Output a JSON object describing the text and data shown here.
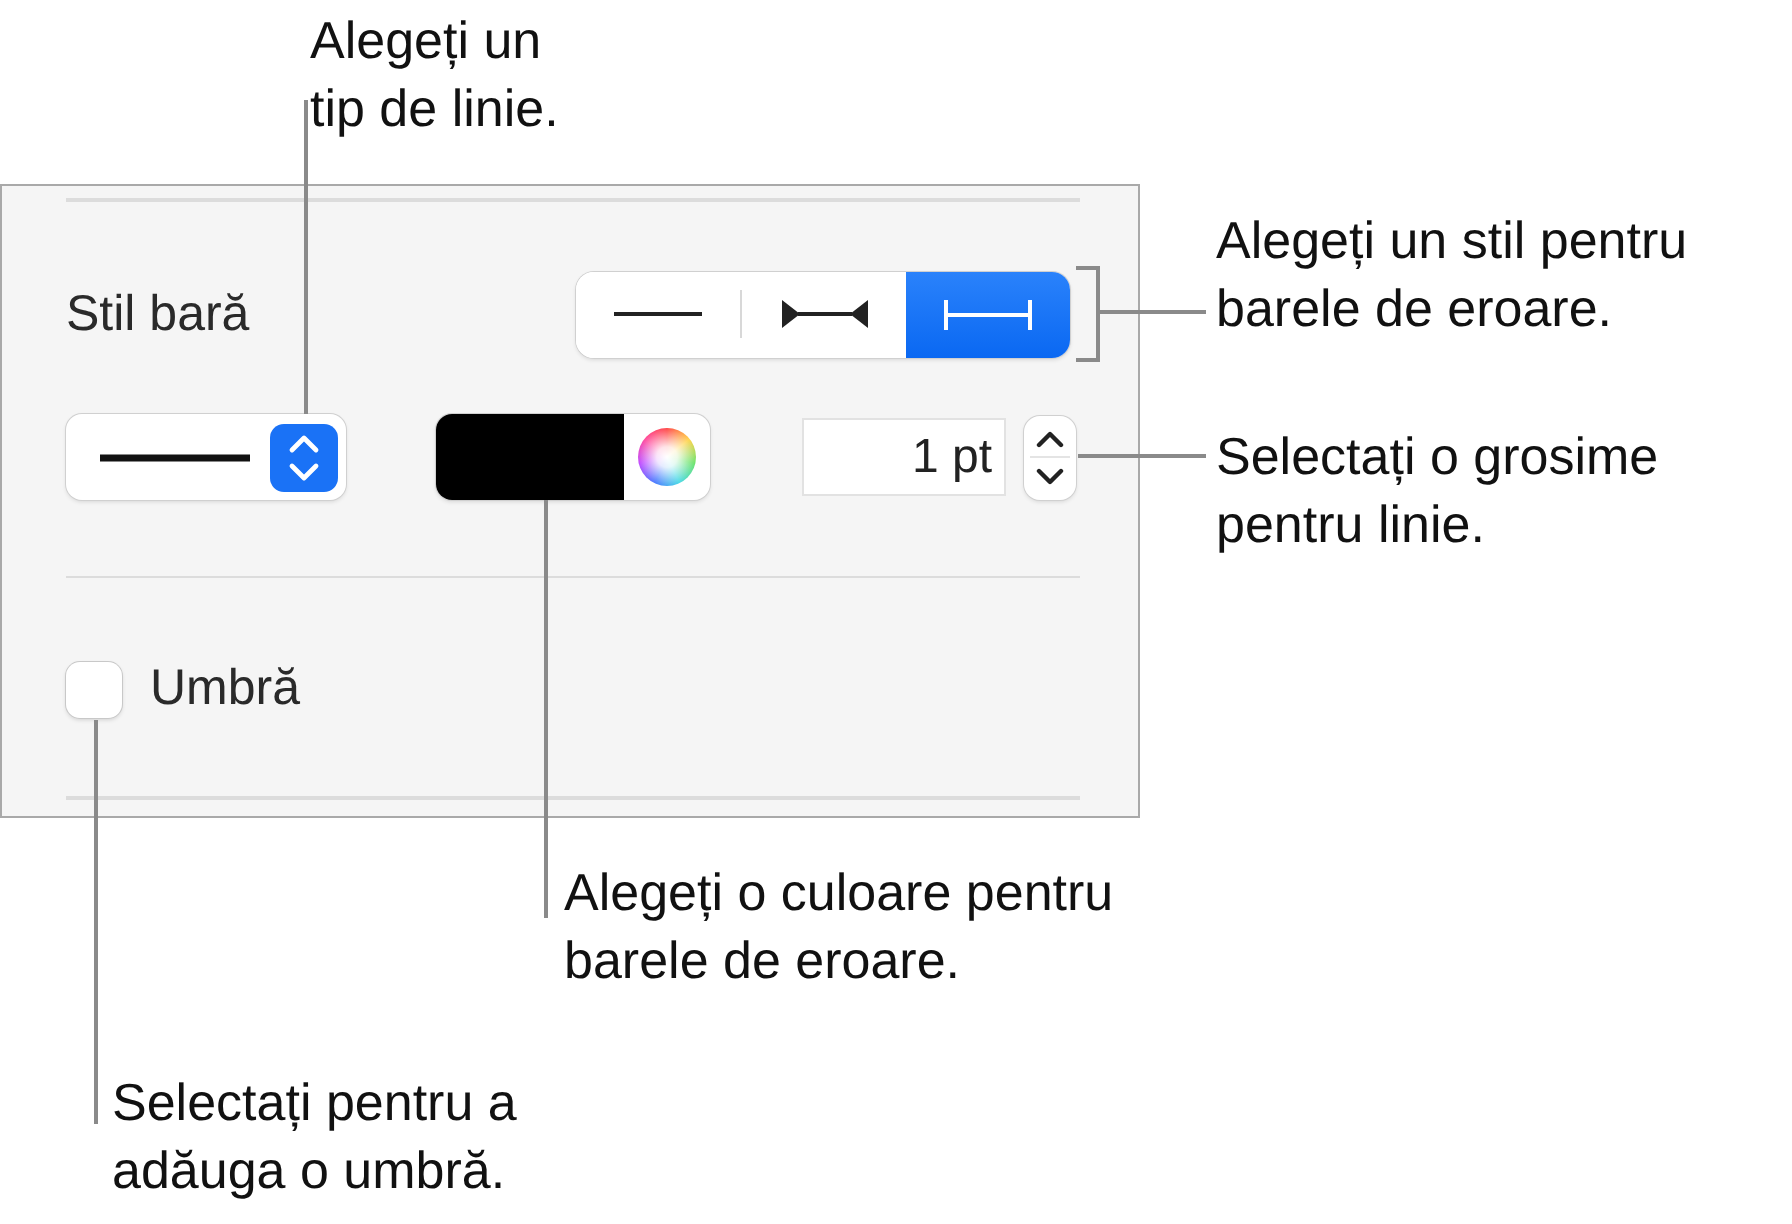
{
  "panel": {
    "bar_style": {
      "label": "Stil bară",
      "options": [
        {
          "kind": "plain",
          "selected": false
        },
        {
          "kind": "inward_arrows",
          "selected": false
        },
        {
          "kind": "capped",
          "selected": true
        }
      ]
    },
    "line_style": {
      "kind": "solid"
    },
    "thickness": {
      "value": "1 pt"
    },
    "shadow": {
      "label": "Umbră",
      "checked": false
    }
  },
  "callouts": [
    {
      "text": "Alegeți un\ntip de linie."
    },
    {
      "text": "Alegeți un stil pentru\nbarele de eroare."
    },
    {
      "text": "Selectați o grosime\npentru linie."
    },
    {
      "text": "Alegeți o culoare pentru\nbarele de eroare."
    },
    {
      "text": "Selectați pentru a\nadăuga o umbră."
    }
  ]
}
